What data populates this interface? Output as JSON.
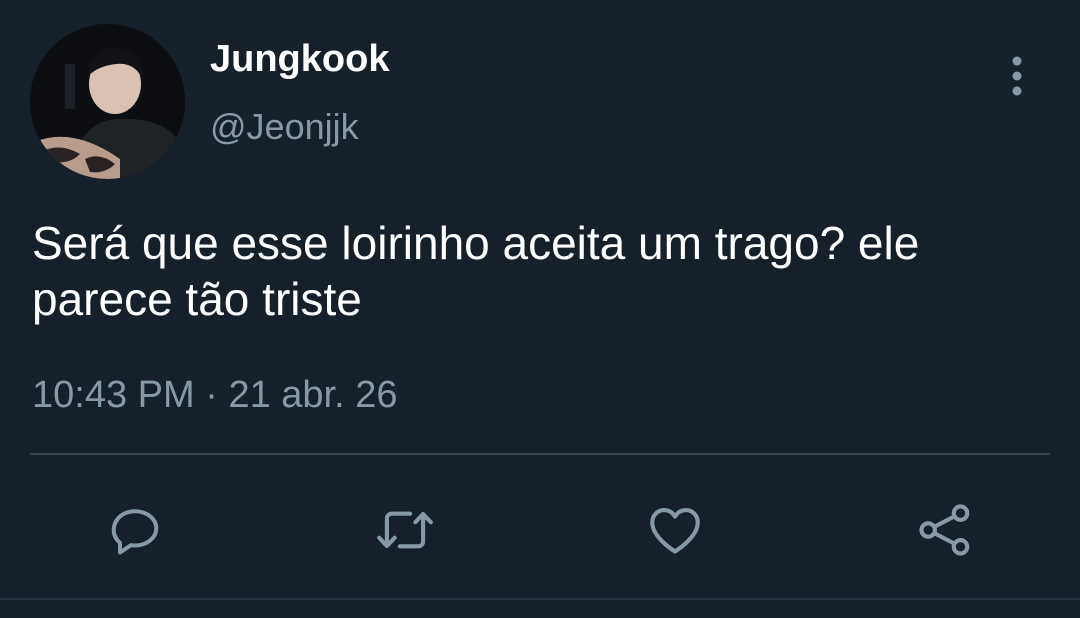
{
  "tweet": {
    "display_name": "Jungkook",
    "handle": "@Jeonjjk",
    "text": "Será que esse loirinho aceita um trago? ele parece tão triste",
    "time": "10:43 PM",
    "separator": " · ",
    "date": "21 abr. 26"
  },
  "actions": {
    "reply_icon": "reply-icon",
    "retweet_icon": "retweet-icon",
    "like_icon": "heart-icon",
    "share_icon": "share-icon",
    "more_icon": "more-vertical-icon"
  },
  "colors": {
    "background": "#15202b",
    "primary_text": "#ffffff",
    "secondary_text": "#8899a6",
    "divider": "#38444d"
  }
}
